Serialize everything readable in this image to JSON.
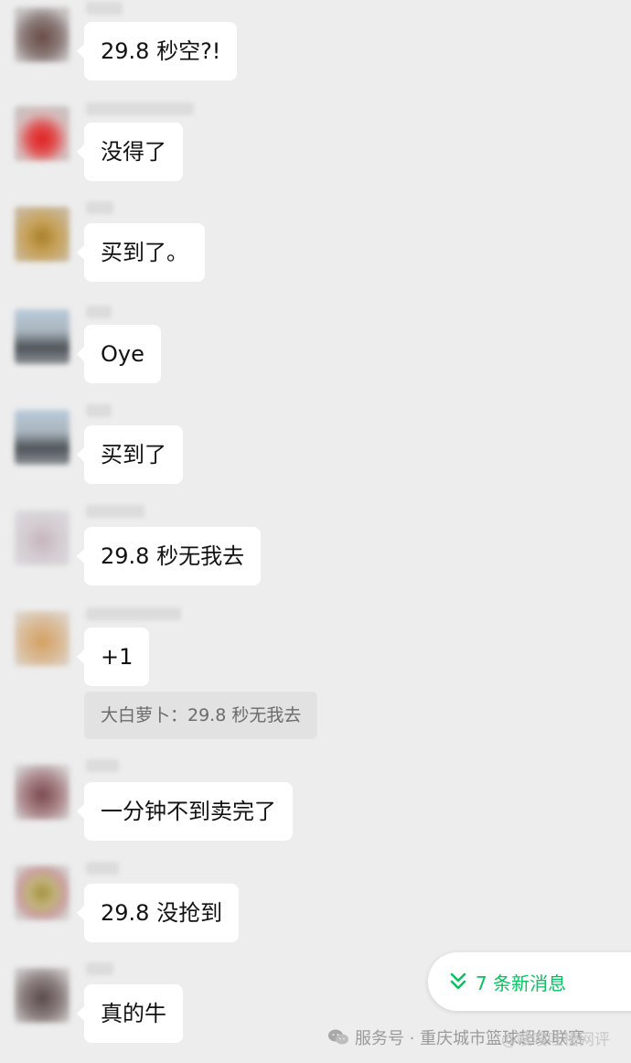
{
  "messages": [
    {
      "text": "29.8 秒空?!"
    },
    {
      "text": "没得了"
    },
    {
      "text": "买到了。"
    },
    {
      "text": "Oye"
    },
    {
      "text": "买到了"
    },
    {
      "text": "29.8 秒无我去"
    },
    {
      "text": "+1",
      "quote": "大白萝卜：29.8 秒无我去"
    },
    {
      "text": "一分钟不到卖完了"
    },
    {
      "text": "29.8 没抢到"
    },
    {
      "text": "真的牛"
    }
  ],
  "new_messages_pill": {
    "label": "7 条新消息",
    "icon": "double-chevron-down-icon",
    "color": "#07c160"
  },
  "watermark": {
    "text": "服务号 · 重庆城市篮球超级联赛",
    "icon": "wechat-icon"
  },
  "weibo_watermark": {
    "text": "@嗖嗖吐槽网评"
  },
  "colors": {
    "background": "#ededed",
    "bubble": "#ffffff",
    "quote_bg": "#e2e2e2",
    "accent": "#07c160"
  }
}
